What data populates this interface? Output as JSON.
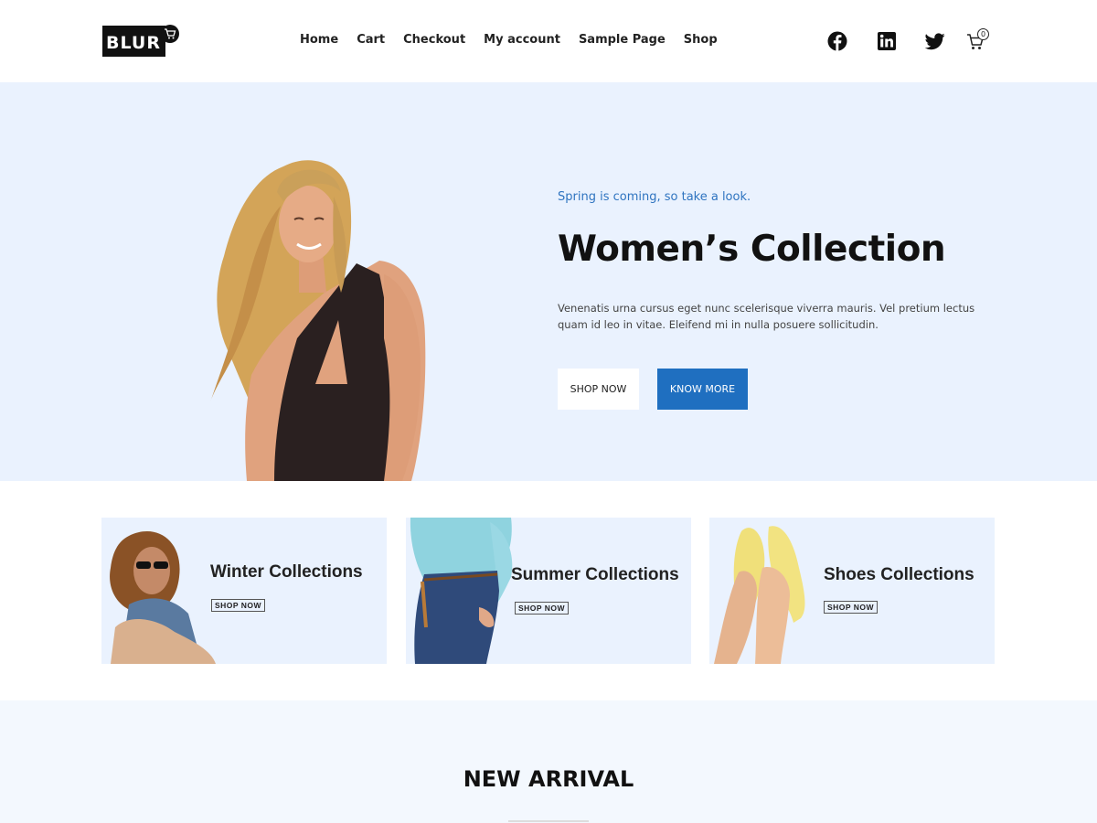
{
  "header": {
    "logo_text": "BLUR",
    "nav": [
      "Home",
      "Cart",
      "Checkout",
      "My account",
      "Sample Page",
      "Shop"
    ],
    "icons": [
      "facebook-icon",
      "linkedin-icon",
      "twitter-icon",
      "cart-icon"
    ],
    "cart_count": "0"
  },
  "hero": {
    "tagline": "Spring is coming, so take a look.",
    "title": "Women’s Collection",
    "description": "Venenatis urna cursus eget nunc scelerisque viverra mauris. Vel pretium lectus quam id leo in vitae. Eleifend mi in nulla posuere sollicitudin.",
    "shop_now_label": "SHOP NOW",
    "know_more_label": "KNOW MORE"
  },
  "categories": [
    {
      "title": "Winter Collections",
      "button": "SHOP NOW"
    },
    {
      "title": "Summer Collections",
      "button": "SHOP NOW"
    },
    {
      "title": "Shoes Collections",
      "button": "SHOP NOW"
    }
  ],
  "new_arrival": {
    "title": "NEW ARRIVAL"
  },
  "colors": {
    "accent": "#1f6fc0",
    "hero_bg": "#eaf2fe",
    "tagline": "#2f74c0",
    "text_dark": "#111111"
  }
}
